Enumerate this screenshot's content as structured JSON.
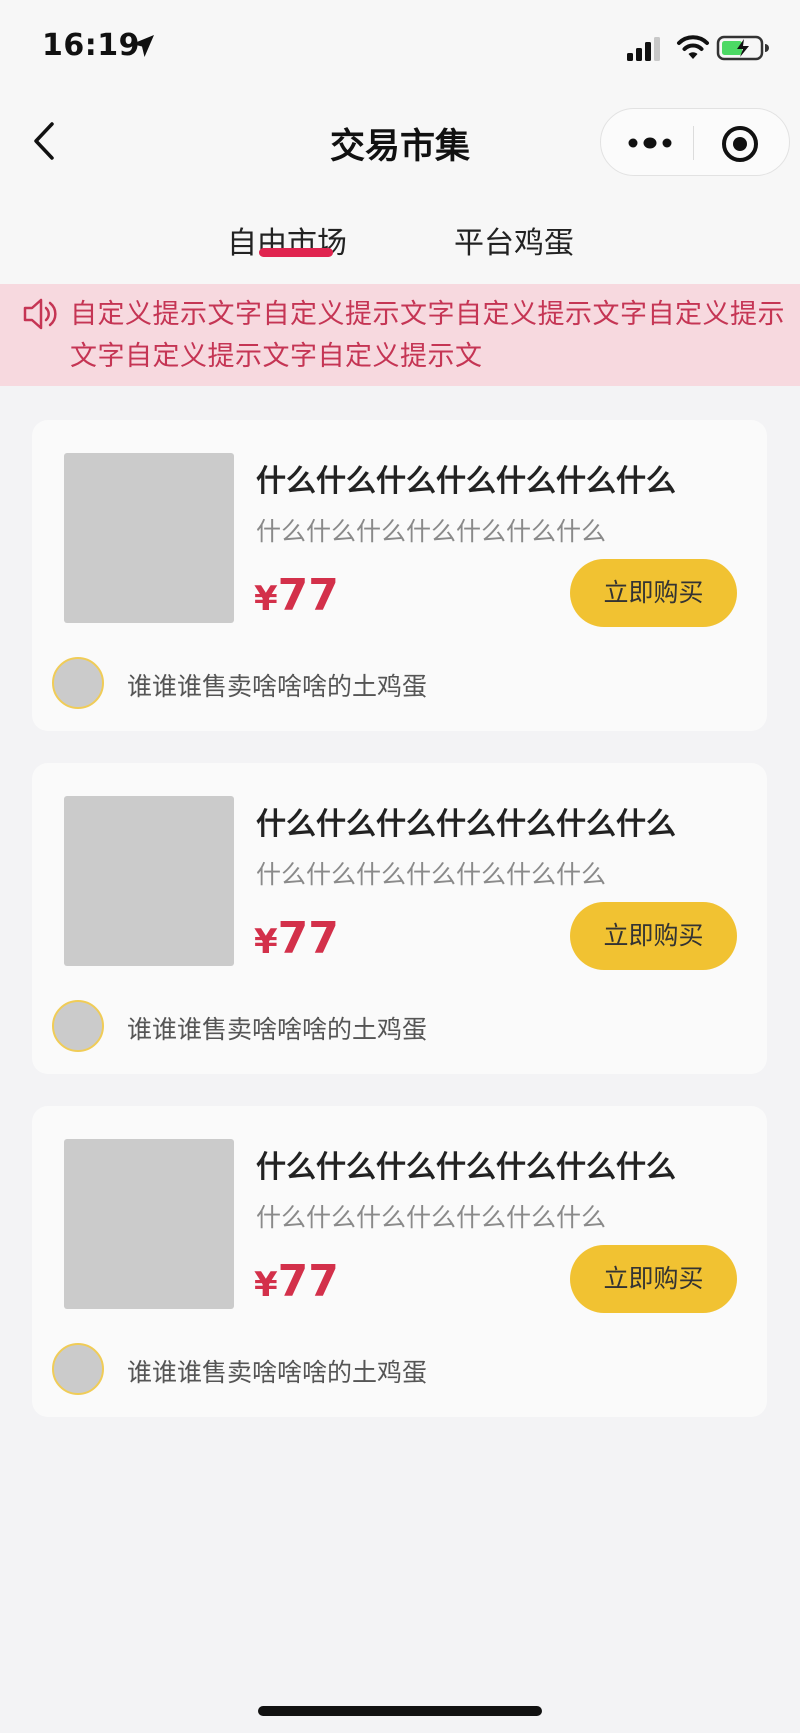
{
  "status_bar": {
    "time": "16:19",
    "icons": [
      "location-arrow-icon",
      "signal-icon",
      "wifi-icon",
      "battery-charging-icon"
    ],
    "battery_color": "#4cd964"
  },
  "nav": {
    "title": "交易市集",
    "back_icon": "chevron-left-icon",
    "capsule_icons": [
      "more-dots-icon",
      "close-target-icon"
    ]
  },
  "tabs": [
    {
      "label": "自由市场",
      "active": true
    },
    {
      "label": "平台鸡蛋",
      "active": false
    }
  ],
  "notice": {
    "icon": "speaker-icon",
    "text": "自定义提示文字自定义提示文字自定义提示文字自定义提示文字自定义提示文字自定义提示文"
  },
  "products": [
    {
      "title": "什么什么什么什么什么什么什么",
      "subtitle": "什么什么什么什么什么什么什么",
      "currency": "¥",
      "price": "77",
      "buy_label": "立即购买",
      "seller": "谁谁谁售卖啥啥啥的土鸡蛋"
    },
    {
      "title": "什么什么什么什么什么什么什么",
      "subtitle": "什么什么什么什么什么什么什么",
      "currency": "¥",
      "price": "77",
      "buy_label": "立即购买",
      "seller": "谁谁谁售卖啥啥啥的土鸡蛋"
    },
    {
      "title": "什么什么什么什么什么什么什么",
      "subtitle": "什么什么什么什么什么什么什么",
      "currency": "¥",
      "price": "77",
      "buy_label": "立即购买",
      "seller": "谁谁谁售卖啥啥啥的土鸡蛋"
    }
  ],
  "colors": {
    "accent": "#e0244f",
    "price": "#d3304a",
    "buy_button": "#f1c232",
    "notice_bg": "#f7d9df",
    "notice_text": "#c53554"
  }
}
